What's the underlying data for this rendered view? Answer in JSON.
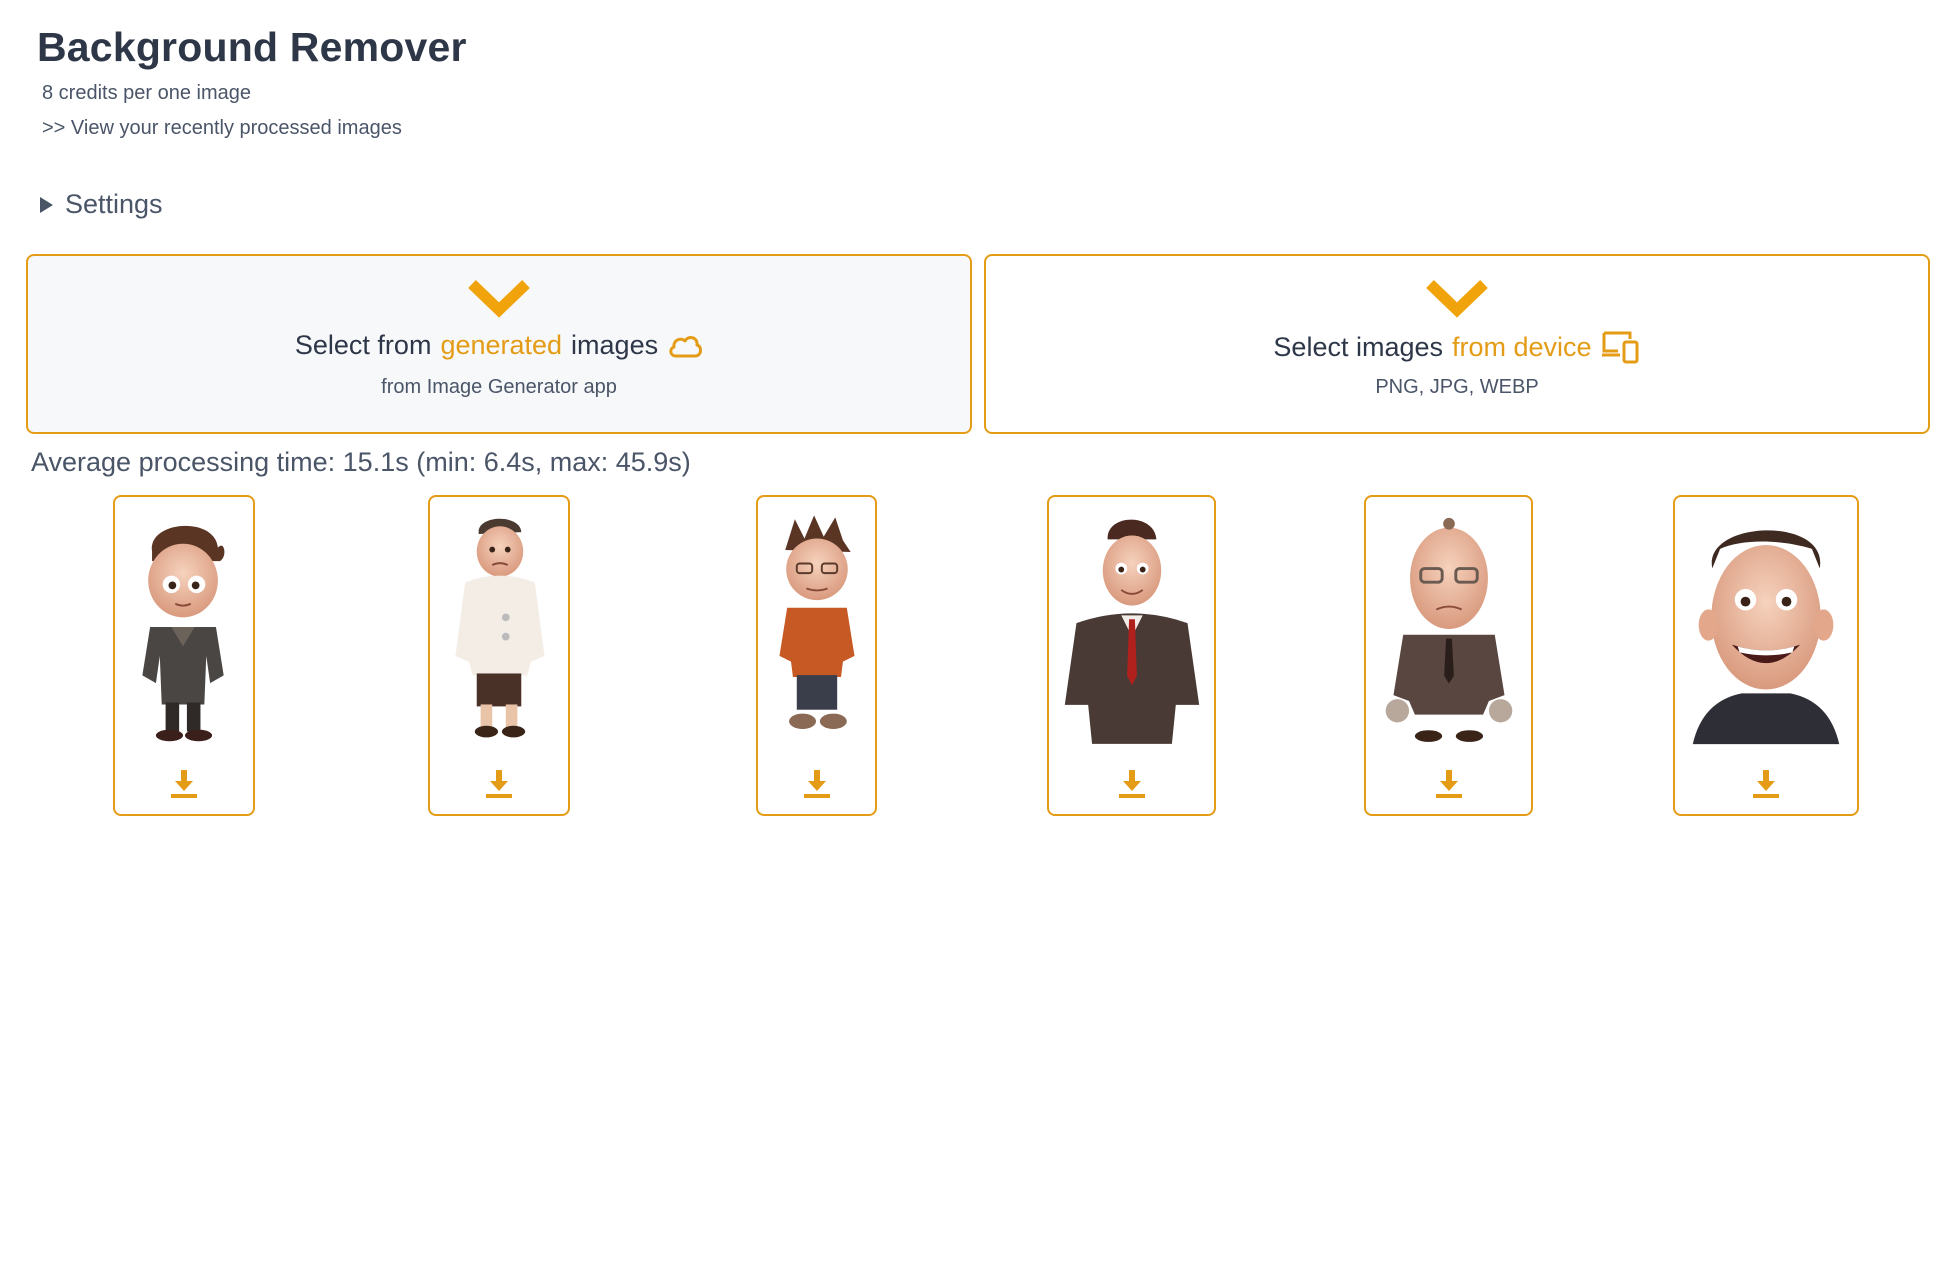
{
  "header": {
    "title": "Background Remover",
    "credits": "8 credits per one image",
    "recent_link": ">> View your recently processed images"
  },
  "settings": {
    "label": "Settings"
  },
  "select_generated": {
    "prefix": "Select from",
    "highlight": "generated",
    "suffix": "images",
    "subtitle": "from Image Generator app",
    "icon": "cloud-icon"
  },
  "select_device": {
    "prefix": "Select images",
    "highlight": "from device",
    "subtitle": "PNG, JPG, WEBP",
    "icon": "devices-icon"
  },
  "processing": {
    "text": "Average processing time: 15.1s (min: 6.4s, max: 45.9s)"
  },
  "images": [
    {
      "icon": "download-icon"
    },
    {
      "icon": "download-icon"
    },
    {
      "icon": "download-icon"
    },
    {
      "icon": "download-icon"
    },
    {
      "icon": "download-icon"
    },
    {
      "icon": "download-icon"
    }
  ],
  "colors": {
    "accent": "#e49c16",
    "text": "#2d3748",
    "muted": "#4a5568",
    "box_bg": "#f7f8fa"
  }
}
